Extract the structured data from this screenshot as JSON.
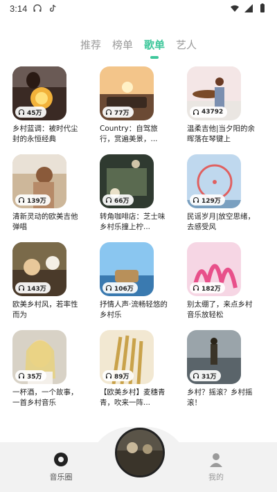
{
  "status_bar": {
    "time": "3:14"
  },
  "tabs": [
    {
      "label": "推荐"
    },
    {
      "label": "榜单"
    },
    {
      "label": "歌单",
      "active": true
    },
    {
      "label": "艺人"
    }
  ],
  "accent_color": "#3ec79b",
  "playlists": [
    {
      "plays": "45万",
      "title": "乡村蓝调：被时代尘封的永恒经典"
    },
    {
      "plays": "77万",
      "title": "Country：自驾旅行，赏遍美景，..."
    },
    {
      "plays": "43792",
      "title": "温柔吉他|当夕阳的余晖落在琴键上"
    },
    {
      "plays": "139万",
      "title": "清新灵动的欧美吉他弹唱"
    },
    {
      "plays": "66万",
      "title": "转角咖啡店：芝士味乡村乐撞上柠..."
    },
    {
      "plays": "129万",
      "title": "民谣岁月|放空思绪，去感受风"
    },
    {
      "plays": "143万",
      "title": "欧美乡村风，若率性而为"
    },
    {
      "plays": "106万",
      "title": "抒情人声·流畅轻悠的乡村乐"
    },
    {
      "plays": "182万",
      "title": "别太绷了，来点乡村音乐放轻松"
    },
    {
      "plays": "35万",
      "title": "一杯酒，一个故事，一首乡村音乐"
    },
    {
      "plays": "89万",
      "title": "【欧美乡村】麦穗青青，吹来一阵..."
    },
    {
      "plays": "31万",
      "title": "乡村？摇滚？乡村摇滚！"
    }
  ],
  "bottom_nav": {
    "left_label": "音乐圈",
    "right_label": "我的"
  }
}
